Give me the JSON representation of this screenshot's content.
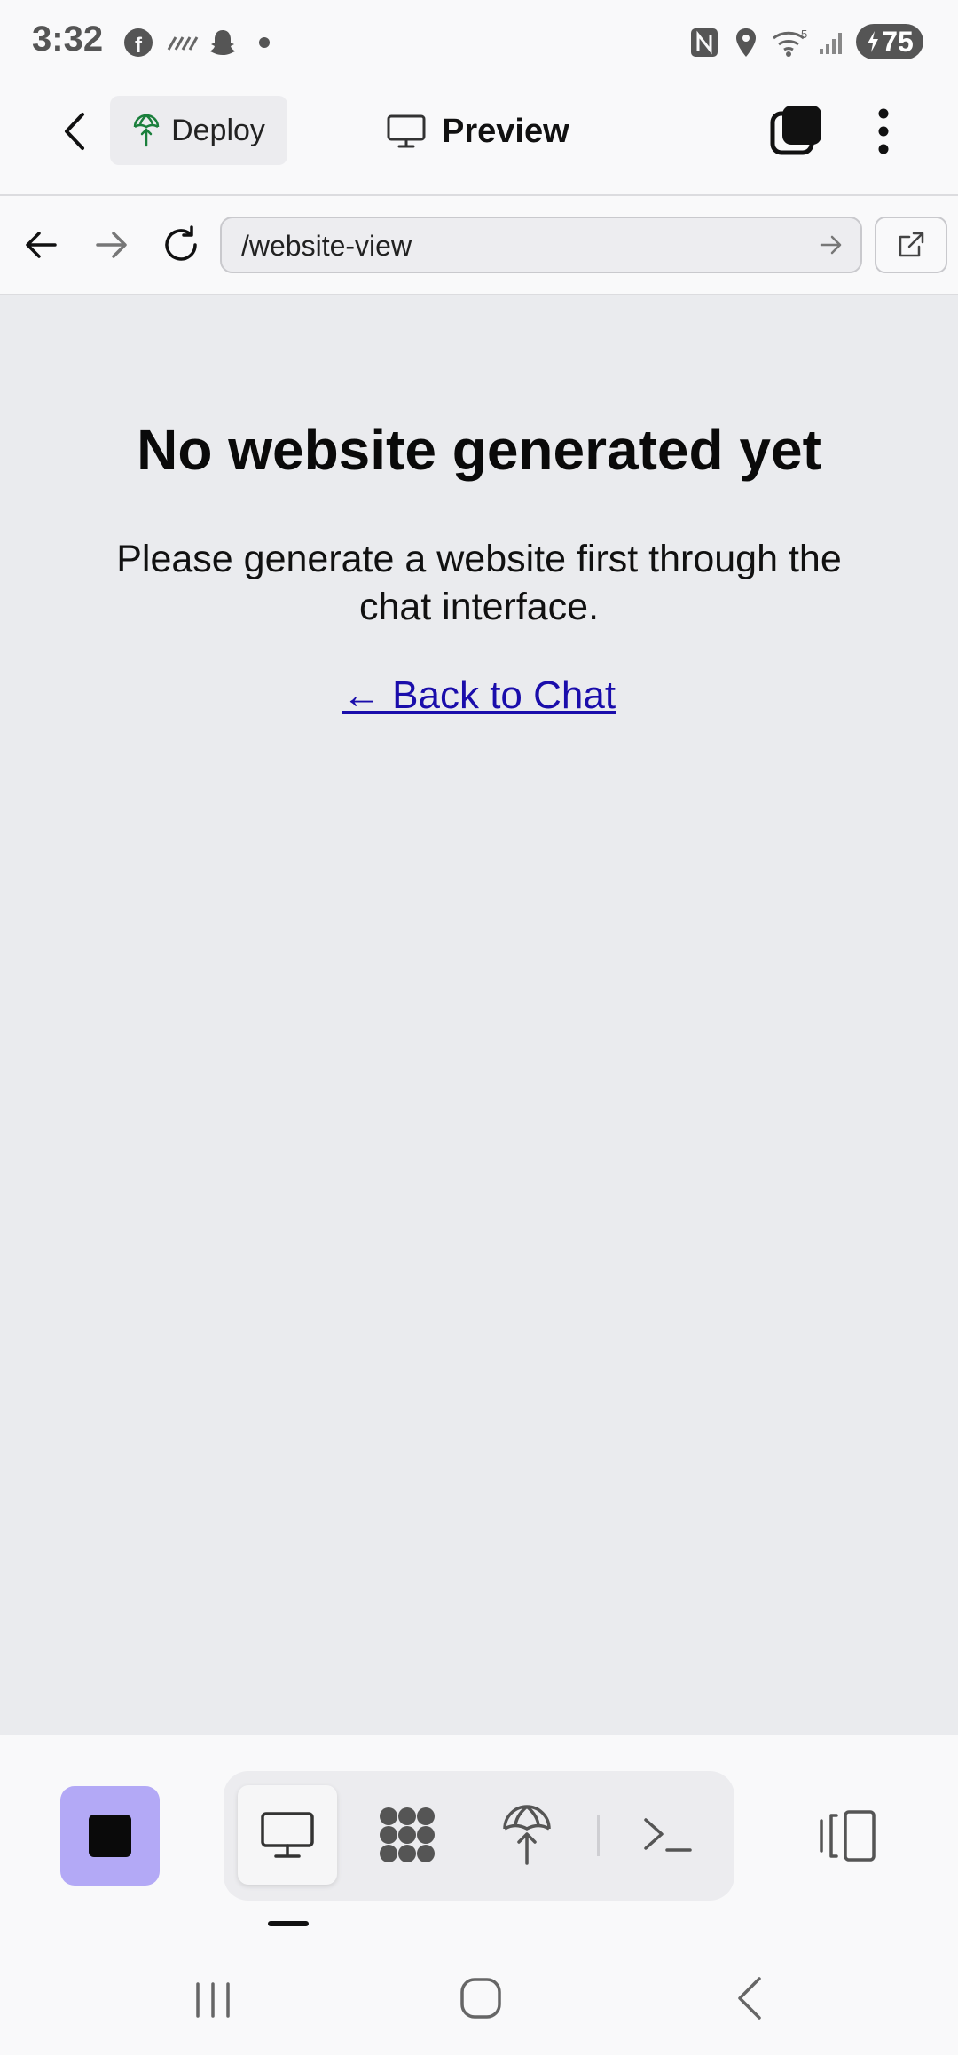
{
  "status_bar": {
    "time": "3:32",
    "battery": "75"
  },
  "header": {
    "deploy_label": "Deploy",
    "preview_label": "Preview"
  },
  "browser": {
    "url": "/website-view"
  },
  "main": {
    "heading": "No website generated yet",
    "message": "Please generate a website first through the chat interface.",
    "back_link": "← Back to Chat"
  },
  "toolbar": {
    "tabs": [
      "preview-monitor",
      "dots-grid",
      "deploy-globe",
      "terminal"
    ]
  },
  "colors": {
    "accent": "#b3a9f6",
    "link": "#1a0dab",
    "content_bg": "#eaebee"
  }
}
